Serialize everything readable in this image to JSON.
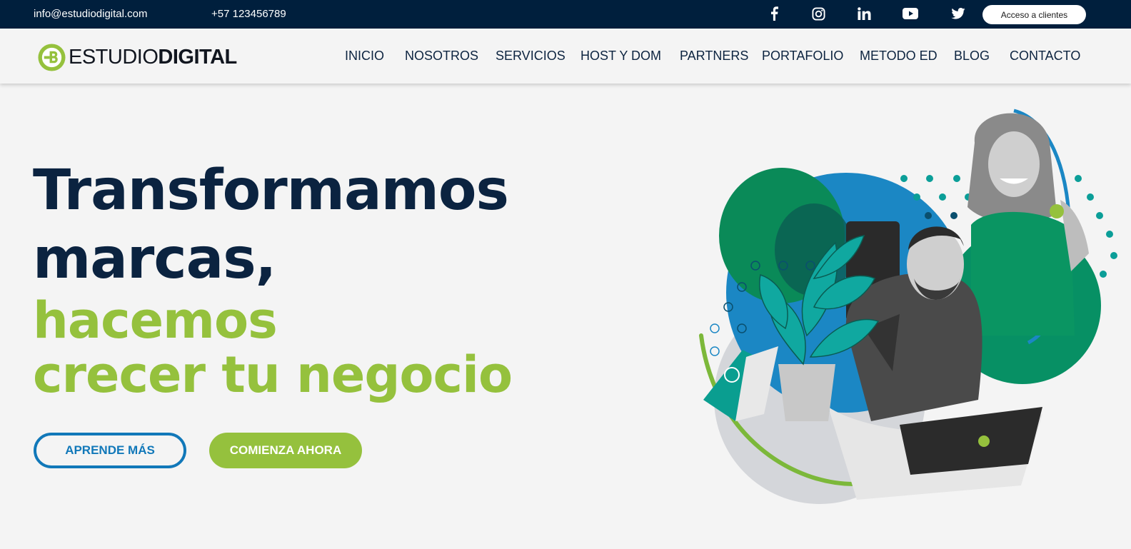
{
  "topbar": {
    "email": "info@estudiodigital.com",
    "phone": "+57 123456789",
    "social_icons": [
      "facebook-icon",
      "instagram-icon",
      "linkedin-icon",
      "youtube-icon",
      "twitter-icon"
    ],
    "client_button": "Acceso a clientes"
  },
  "brand": {
    "name_light": "ESTUDIO",
    "name_bold": "DIGITAL"
  },
  "nav": {
    "items": [
      "INICIO",
      "NOSOTROS",
      "SERVICIOS",
      "HOST Y DOM",
      "PARTNERS",
      "PORTAFOLIO",
      "METODO ED",
      "BLOG",
      "CONTACTO"
    ]
  },
  "hero": {
    "line1": "Transformamos",
    "line2": "marcas,",
    "line3": "hacemos",
    "line4": "crecer tu negocio",
    "button_learn": "APRENDE MÁS",
    "button_start": "COMIENZA AHORA"
  },
  "colors": {
    "navy": "#001f3d",
    "green": "#95c13d",
    "blue": "#1178b9",
    "teal": "#009688"
  }
}
